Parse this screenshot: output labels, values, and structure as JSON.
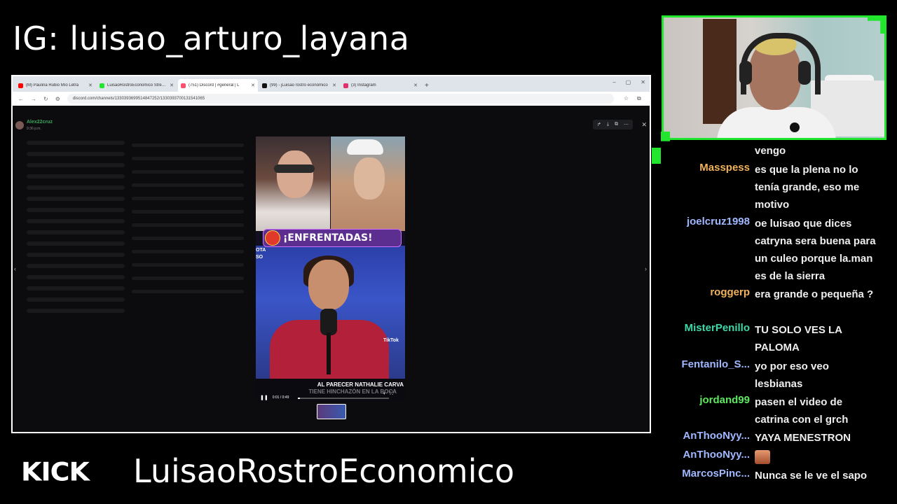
{
  "overlay": {
    "ig_handle": "IG: luisao_arturo_layana",
    "platform_logo": "KICK",
    "channel_name": "LuisaoRostroEconomico",
    "accent_color": "#22e52d"
  },
  "browser": {
    "tabs": [
      {
        "label": "(M) Paulina Rubio Mío Letra",
        "favicon": "youtube-icon",
        "color": "#ff0000",
        "active": false
      },
      {
        "label": "LuisaoRostroEconomico Stream",
        "favicon": "kick-icon",
        "color": "#22e52d",
        "active": false
      },
      {
        "label": "(751) Discord | #general | L",
        "favicon": "discord-icon",
        "color": "#ff4f6f",
        "active": true
      },
      {
        "label": "(99) - jLuisao rostro económico",
        "favicon": "tiktok-icon",
        "color": "#111111",
        "active": false
      },
      {
        "label": "(3) Instagram",
        "favicon": "instagram-icon",
        "color": "#e1306c",
        "active": false
      }
    ],
    "url": "discord.com/channels/1330393699514847252/1330393700131541065"
  },
  "discord": {
    "uploader": "Alex22cruz",
    "upload_time": "9:36 p.m.",
    "video": {
      "banner": "¡ENFRENTADAS!",
      "side_label": "OTA\nSO",
      "subtitle": "AL PARECER NATHALIE CARVA",
      "subtitle2": "TIENE HINCHAZÓN EN LA BOCA",
      "watermark": "TikTok",
      "time": "0:01 / 0:49",
      "progress": 0.02
    }
  },
  "chat": [
    {
      "user": "",
      "text": "vengo",
      "color": "#ffffff"
    },
    {
      "user": "Masspess",
      "text": "es que la plena no lo tenía grande, eso me motivo",
      "color": "#f0b25a"
    },
    {
      "user": "joelcruz1998",
      "text": "oe luisao que dices catryna sera buena para un culeo porque la.man es de la sierra",
      "color": "#9fb8ff"
    },
    {
      "user": "roggerp",
      "text": "era grande o pequeña ?",
      "color": "#f0b25a"
    },
    {
      "user": "MisterPenillo",
      "text": "TU SOLO VES LA PALOMA",
      "color": "#3fd9a8"
    },
    {
      "user": "Fentanilo_S...",
      "text": "yo por eso veo lesbianas",
      "color": "#9fb8ff"
    },
    {
      "user": "jordand99",
      "text": "pasen el video de catrina con el grch",
      "color": "#5ee85e"
    },
    {
      "user": "AnThooNyy...",
      "text": "YAYA MENESTRON",
      "color": "#9fb8ff"
    },
    {
      "user": "AnThooNyy...",
      "text": "",
      "color": "#9fb8ff",
      "emote": "emote"
    },
    {
      "user": "MarcosPinc...",
      "text": "Nunca se le ve el sapo",
      "color": "#9fb8ff"
    }
  ]
}
